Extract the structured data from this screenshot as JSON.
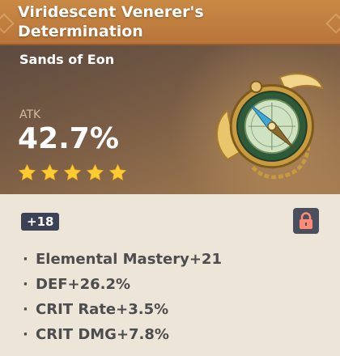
{
  "artifact": {
    "name": "Viridescent Venerer's Determination",
    "slot": "Sands of Eon",
    "main_stat": {
      "label": "ATK",
      "value": "42.7%"
    },
    "rarity": 5,
    "level": "+18",
    "locked": true,
    "sub_stats": [
      "Elemental Mastery+21",
      "DEF+26.2%",
      "CRIT Rate+3.5%",
      "CRIT DMG+7.8%"
    ],
    "icons": {
      "artifact": "compass-icon",
      "lock": "lock-icon",
      "star": "star-icon"
    }
  },
  "colors": {
    "title_bar": "#bc7a3e",
    "star": "#ffcc32",
    "lock": "#ff8a75",
    "level_badge": "#3b4255",
    "body_bg": "#ece5d8"
  }
}
